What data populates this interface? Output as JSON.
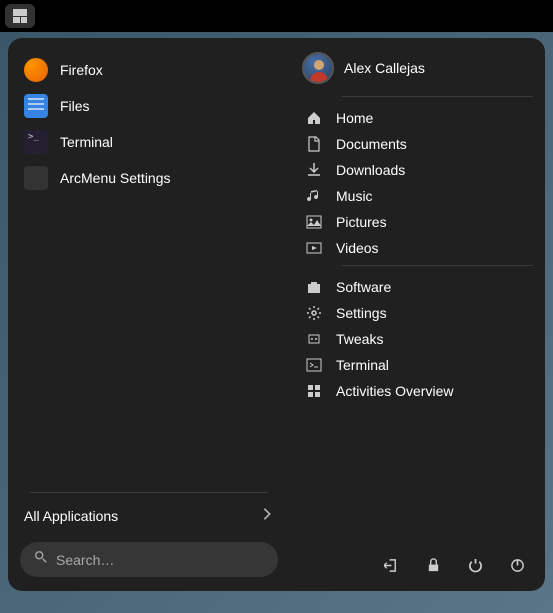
{
  "apps": [
    {
      "label": "Firefox",
      "icon": "firefox"
    },
    {
      "label": "Files",
      "icon": "files"
    },
    {
      "label": "Terminal",
      "icon": "terminal"
    },
    {
      "label": "ArcMenu Settings",
      "icon": "arcmenu"
    }
  ],
  "all_apps_label": "All Applications",
  "search": {
    "placeholder": "Search…"
  },
  "user": {
    "name": "Alex Callejas"
  },
  "places": [
    {
      "label": "Home",
      "icon": "home"
    },
    {
      "label": "Documents",
      "icon": "document"
    },
    {
      "label": "Downloads",
      "icon": "download"
    },
    {
      "label": "Music",
      "icon": "music"
    },
    {
      "label": "Pictures",
      "icon": "picture"
    },
    {
      "label": "Videos",
      "icon": "video"
    }
  ],
  "system": [
    {
      "label": "Software",
      "icon": "software"
    },
    {
      "label": "Settings",
      "icon": "gear"
    },
    {
      "label": "Tweaks",
      "icon": "tweaks"
    },
    {
      "label": "Terminal",
      "icon": "terminal-sym"
    },
    {
      "label": "Activities Overview",
      "icon": "activities"
    }
  ],
  "power": [
    {
      "name": "logout"
    },
    {
      "name": "lock"
    },
    {
      "name": "restart"
    },
    {
      "name": "shutdown"
    }
  ]
}
